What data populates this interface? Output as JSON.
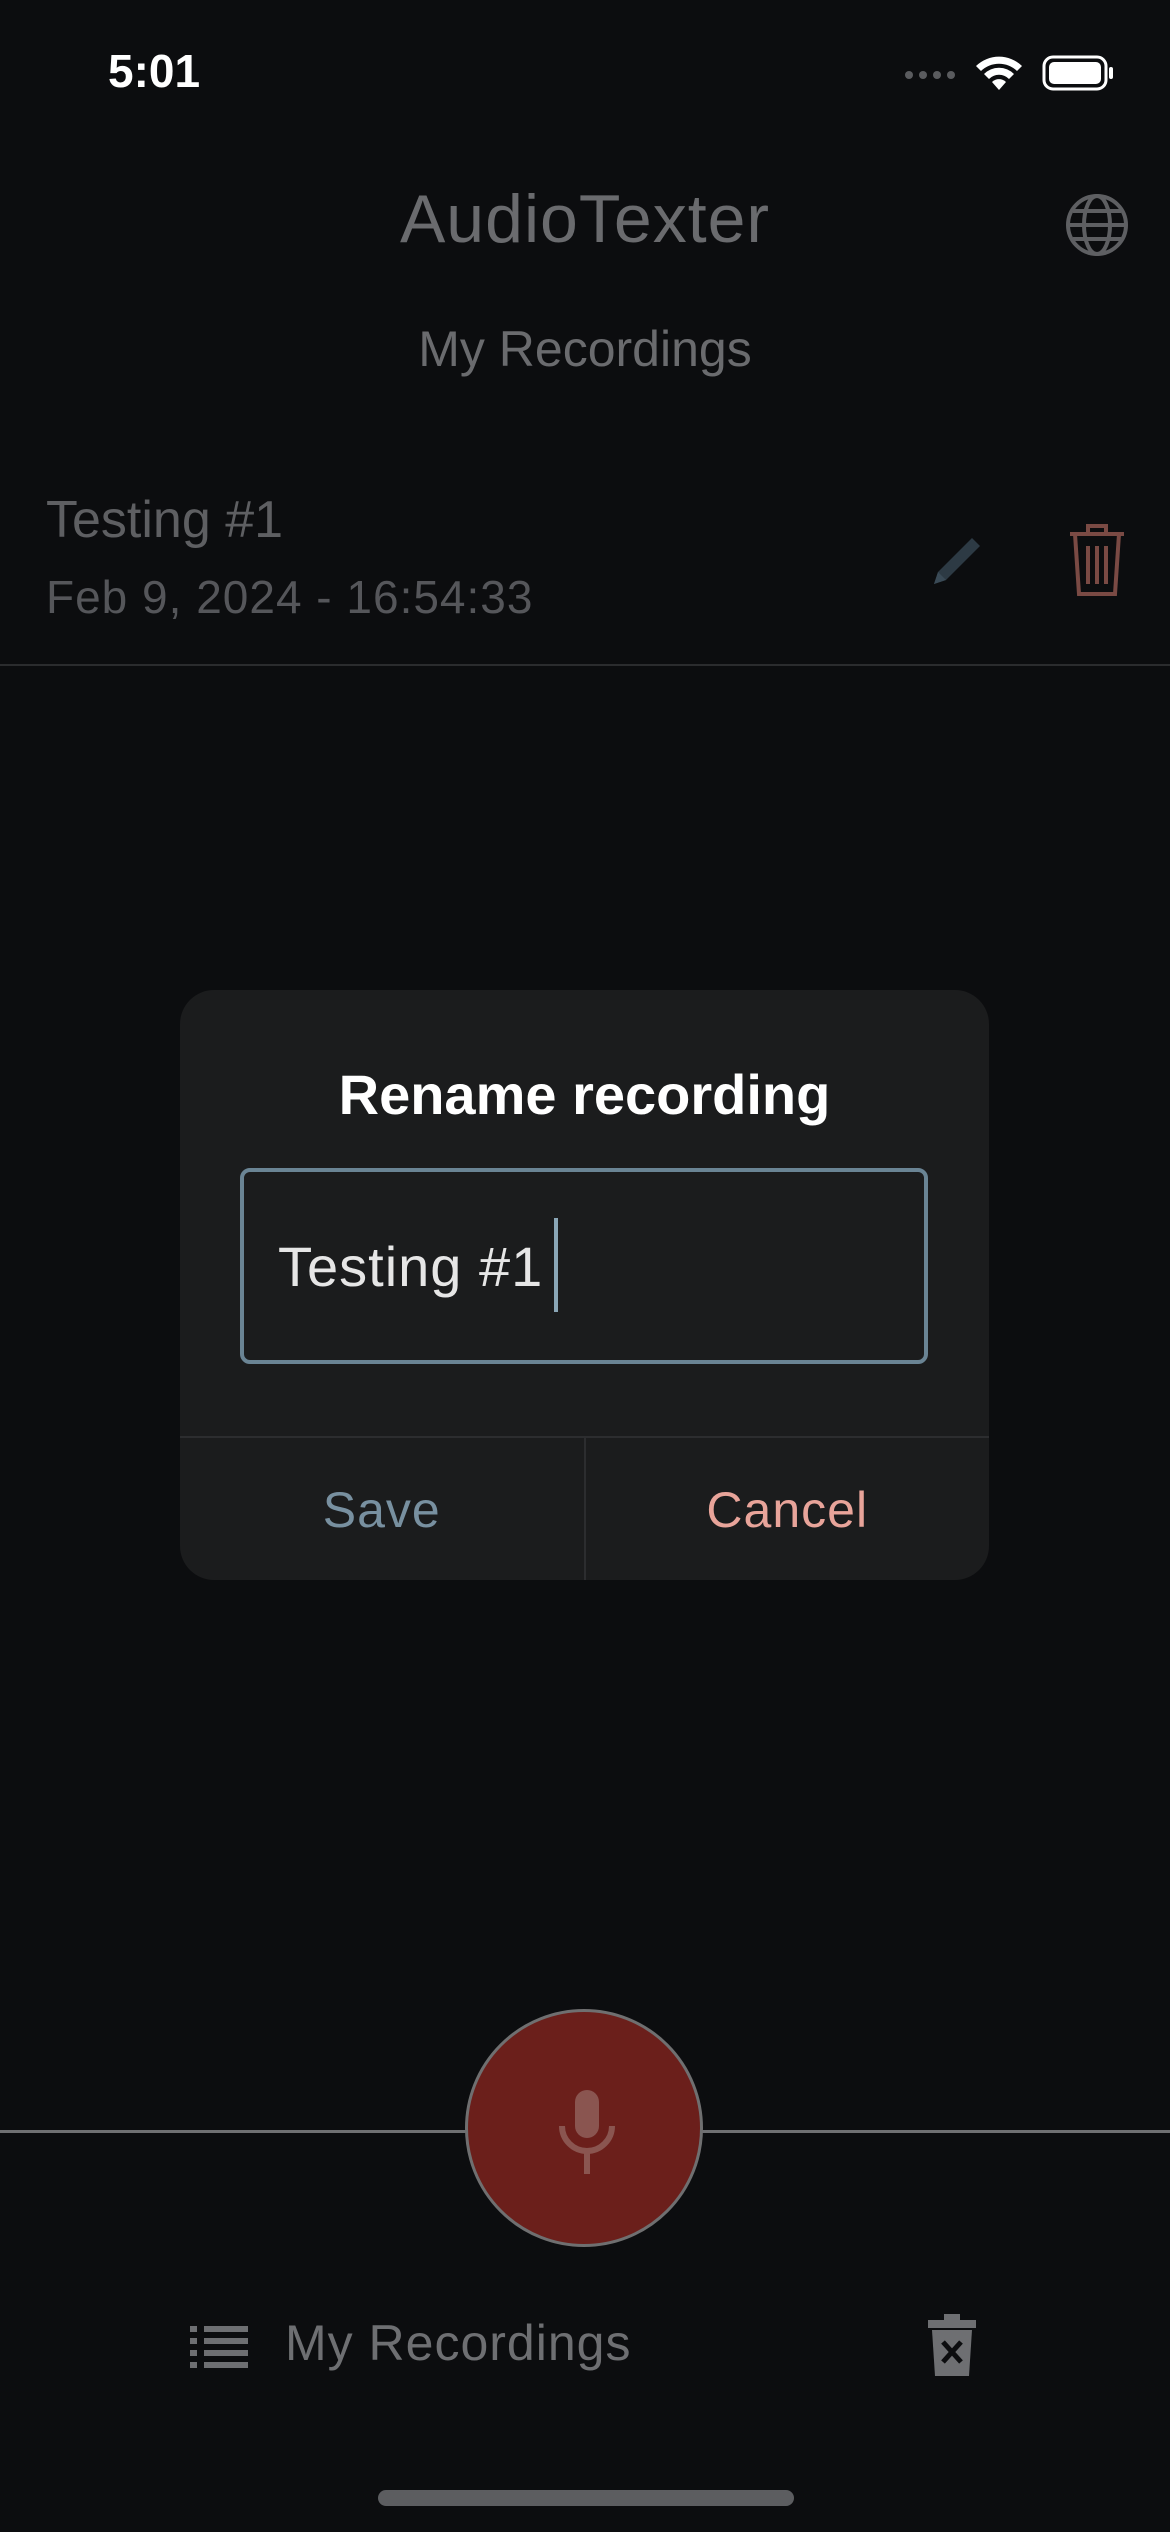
{
  "status_bar": {
    "time": "5:01"
  },
  "header": {
    "app_title": "AudioTexter",
    "subtitle": "My Recordings"
  },
  "recordings": [
    {
      "name": "Testing #1",
      "date": "Feb 9, 2024 - 16:54:33"
    }
  ],
  "dialog": {
    "title": "Rename recording",
    "input_value": "Testing #1",
    "save_label": "Save",
    "cancel_label": "Cancel"
  },
  "bottom_nav": {
    "recordings_label": "My Recordings"
  },
  "icons": {
    "globe": "globe-icon",
    "edit": "pencil-icon",
    "delete": "trash-icon",
    "record": "microphone-icon",
    "list": "list-icon",
    "clear_all": "trash-x-icon"
  },
  "colors": {
    "background": "#0c0d0f",
    "dialog": "#1b1c1d",
    "record_button": "#6b1f1b",
    "cancel": "#e8a49a",
    "save": "#7890a0",
    "input_border": "#6a8494"
  }
}
